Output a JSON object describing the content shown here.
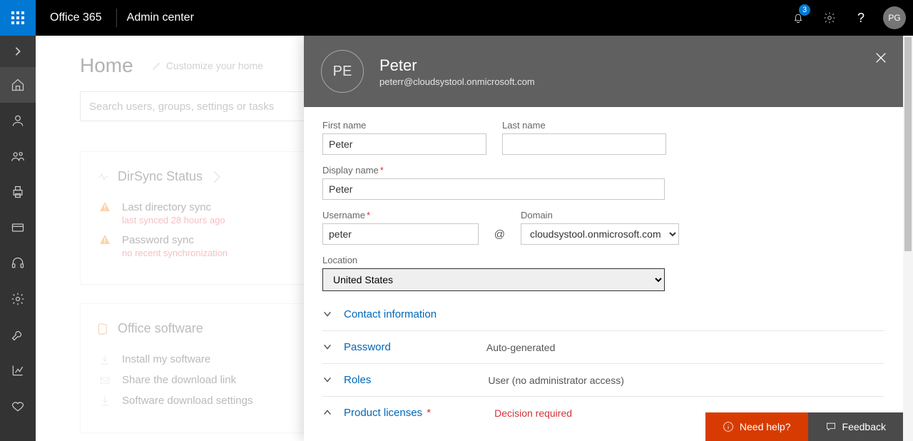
{
  "header": {
    "brand1": "Office 365",
    "brand2": "Admin center",
    "notification_count": "3",
    "avatar_initials": "PG"
  },
  "home": {
    "title": "Home",
    "customize": "Customize your home",
    "search_placeholder": "Search users, groups, settings or tasks"
  },
  "dirsync": {
    "title": "DirSync Status",
    "items": [
      {
        "label": "Last directory sync",
        "sub": "last synced 28 hours ago"
      },
      {
        "label": "Password sync",
        "sub": "no recent synchronization"
      }
    ]
  },
  "software": {
    "title": "Office software",
    "items": [
      "Install my software",
      "Share the download link",
      "Software download settings"
    ]
  },
  "panel": {
    "initials": "PE",
    "name": "Peter",
    "email": "peterr@cloudsystool.onmicrosoft.com",
    "labels": {
      "first_name": "First name",
      "last_name": "Last name",
      "display_name": "Display name",
      "username": "Username",
      "domain": "Domain",
      "location": "Location",
      "contact": "Contact information",
      "password": "Password",
      "roles": "Roles",
      "licenses": "Product licenses"
    },
    "values": {
      "first_name": "Peter",
      "last_name": "",
      "display_name": "Peter",
      "username": "peter",
      "domain": "cloudsystool.onmicrosoft.com",
      "location": "United States",
      "password_summary": "Auto-generated",
      "roles_summary": "User (no administrator access)",
      "licenses_summary": "Decision required"
    }
  },
  "helpbar": {
    "need_help": "Need help?",
    "feedback": "Feedback"
  }
}
